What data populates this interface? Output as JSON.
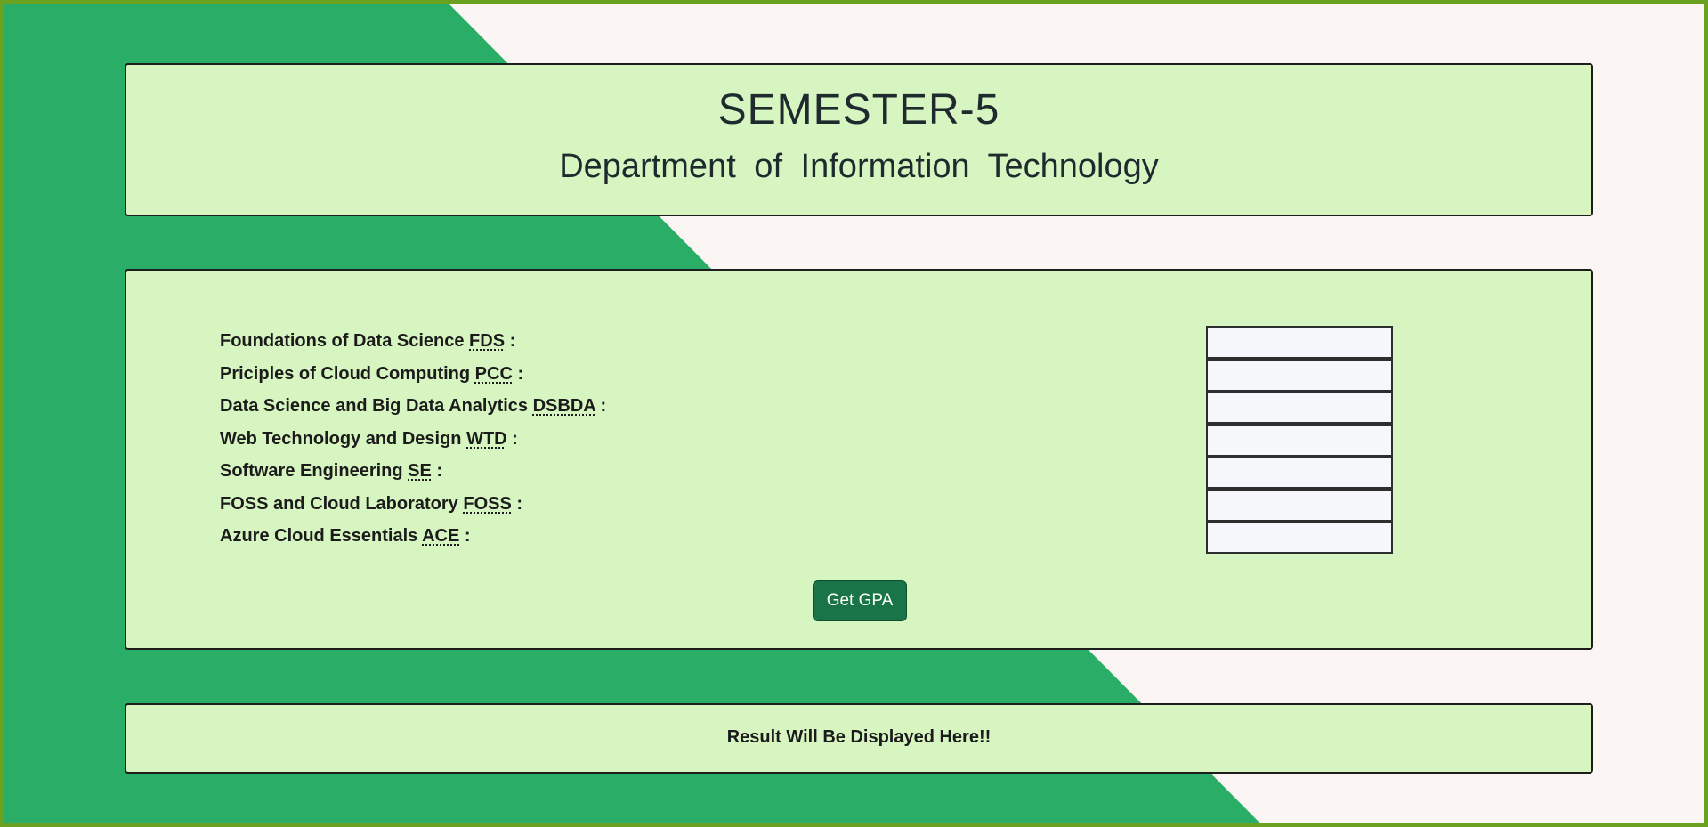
{
  "header": {
    "title": "SEMESTER-5",
    "subtitle": "Department of Information Technology"
  },
  "form": {
    "subjects": [
      {
        "name": "Foundations of Data Science",
        "abbr": "FDS",
        "suffix": " :",
        "value": ""
      },
      {
        "name": "Priciples of Cloud Computing",
        "abbr": "PCC",
        "suffix": " :",
        "value": ""
      },
      {
        "name": "Data Science and Big Data Analytics",
        "abbr": "DSBDA",
        "suffix": " :",
        "value": ""
      },
      {
        "name": "Web Technology and Design",
        "abbr": "WTD",
        "suffix": " :",
        "value": ""
      },
      {
        "name": "Software Engineering",
        "abbr": "SE",
        "suffix": " :",
        "value": ""
      },
      {
        "name": "FOSS and Cloud Laboratory",
        "abbr": "FOSS",
        "suffix": " :",
        "value": ""
      },
      {
        "name": "Azure Cloud Essentials",
        "abbr": "ACE",
        "suffix": " :",
        "value": ""
      }
    ],
    "submit_label": "Get GPA"
  },
  "result": {
    "text": "Result Will Be Displayed Here!!"
  },
  "colors": {
    "frame_border": "#6aa121",
    "green_band": "#2aae67",
    "page_bg": "#fbf5f3",
    "panel_bg": "#d7f5c0",
    "button_bg": "#197547"
  }
}
